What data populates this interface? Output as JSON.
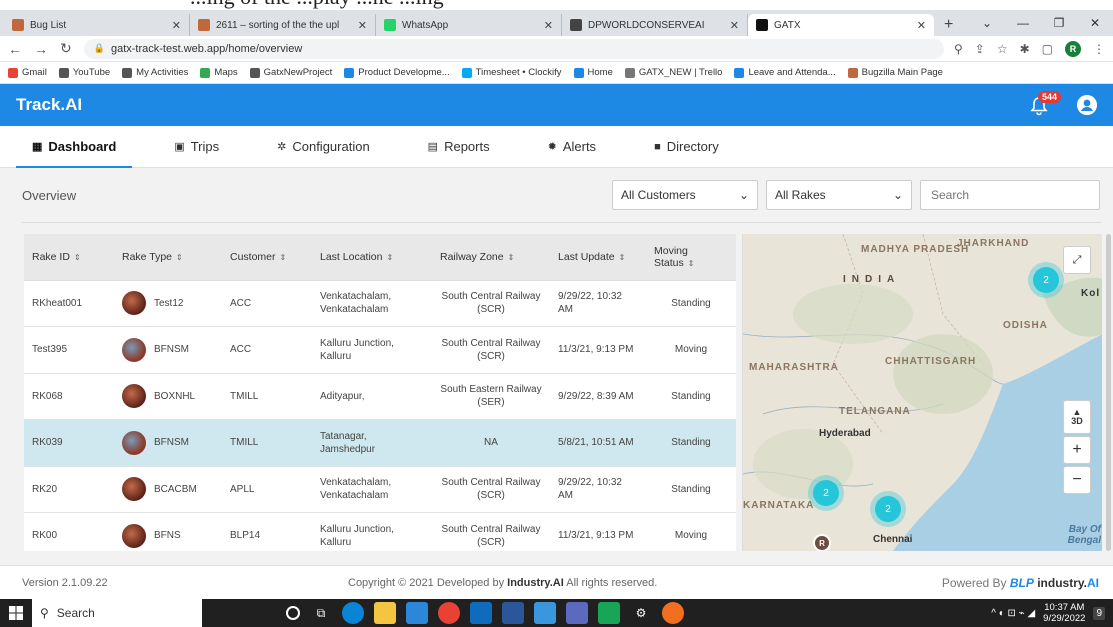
{
  "top_caption": "...ing of the ...play ...ne ...ing",
  "browser": {
    "tabs": [
      {
        "label": "Bug List",
        "color": "#c0673c",
        "active": false
      },
      {
        "label": "2611 – sorting of the the upl",
        "color": "#c0673c",
        "active": false
      },
      {
        "label": "WhatsApp",
        "color": "#25d366",
        "active": false
      },
      {
        "label": "DPWORLDCONSERVEAI",
        "color": "#444444",
        "active": false
      },
      {
        "label": "GATX",
        "color": "#111111",
        "active": true
      }
    ],
    "url": "gatx-track-test.web.app/home/overview",
    "profile_initial": "R",
    "bookmarks": [
      {
        "label": "Gmail",
        "color": "#ea4335"
      },
      {
        "label": "YouTube",
        "color": "#555555"
      },
      {
        "label": "My Activities",
        "color": "#555555"
      },
      {
        "label": "Maps",
        "color": "#34a853"
      },
      {
        "label": "GatxNewProject",
        "color": "#555555"
      },
      {
        "label": "Product Developme...",
        "color": "#1e88e5"
      },
      {
        "label": "Timesheet • Clockify",
        "color": "#03a9f4"
      },
      {
        "label": "Home",
        "color": "#1e88e5"
      },
      {
        "label": "GATX_NEW | Trello",
        "color": "#777777"
      },
      {
        "label": "Leave and Attenda...",
        "color": "#1e88e5"
      },
      {
        "label": "Bugzilla Main Page",
        "color": "#c0673c"
      }
    ]
  },
  "app": {
    "brand": "Track.AI",
    "notification_count": "544",
    "nav": [
      {
        "label": "Dashboard",
        "icon": "dashboard-icon",
        "glyph": "▦",
        "active": true
      },
      {
        "label": "Trips",
        "icon": "trips-icon",
        "glyph": "▣",
        "active": false
      },
      {
        "label": "Configuration",
        "icon": "gear-icon",
        "glyph": "✲",
        "active": false
      },
      {
        "label": "Reports",
        "icon": "report-icon",
        "glyph": "▤",
        "active": false
      },
      {
        "label": "Alerts",
        "icon": "alerts-icon",
        "glyph": "✹",
        "active": false
      },
      {
        "label": "Directory",
        "icon": "folder-icon",
        "glyph": "■",
        "active": false
      }
    ],
    "overview_title": "Overview",
    "customer_select": "All Customers",
    "rake_select": "All Rakes",
    "search_placeholder": "Search"
  },
  "table": {
    "headers": [
      "Rake ID",
      "Rake Type",
      "Customer",
      "Last Location",
      "Railway Zone",
      "Last Update",
      "Moving Status"
    ],
    "rows": [
      {
        "rake_id": "RKheat001",
        "rake_type": "Test12",
        "customer": "ACC",
        "location": "Venkatachalam, Venkatachalam",
        "zone": "South Central Railway (SCR)",
        "update": "9/29/22, 10:32 AM",
        "status": "Standing",
        "highlight": false
      },
      {
        "rake_id": "Test395",
        "rake_type": "BFNSM",
        "customer": "ACC",
        "location": "Kalluru Junction, Kalluru",
        "zone": "South Central Railway (SCR)",
        "update": "11/3/21, 9:13 PM",
        "status": "Moving",
        "highlight": false
      },
      {
        "rake_id": "RK068",
        "rake_type": "BOXNHL",
        "customer": "TMILL",
        "location": "Adityapur,",
        "zone": "South Eastern Railway (SER)",
        "update": "9/29/22, 8:39 AM",
        "status": "Standing",
        "highlight": false
      },
      {
        "rake_id": "RK039",
        "rake_type": "BFNSM",
        "customer": "TMILL",
        "location": "Tatanagar, Jamshedpur",
        "zone": "NA",
        "update": "5/8/21, 10:51 AM",
        "status": "Standing",
        "highlight": true
      },
      {
        "rake_id": "RK20",
        "rake_type": "BCACBM",
        "customer": "APLL",
        "location": "Venkatachalam, Venkatachalam",
        "zone": "South Central Railway (SCR)",
        "update": "9/29/22, 10:32 AM",
        "status": "Standing",
        "highlight": false
      },
      {
        "rake_id": "RK00",
        "rake_type": "BFNS",
        "customer": "BLP14",
        "location": "Kalluru Junction, Kalluru",
        "zone": "South Central Railway (SCR)",
        "update": "11/3/21, 9:13 PM",
        "status": "Moving",
        "highlight": false
      }
    ]
  },
  "map": {
    "labels": [
      "MADHYA PRADESH",
      "JHARKHAND",
      "INDIA",
      "Kol",
      "ODISHA",
      "MAHARASHTRA",
      "CHHATTISGARH",
      "TELANGANA",
      "Hyderabad",
      "KARNATAKA",
      "Chennai",
      "Bay Of Bengal"
    ],
    "clusters": [
      "2",
      "2",
      "2"
    ],
    "marker": "R",
    "btn_3d": "3D",
    "zoom_in": "+",
    "zoom_out": "−"
  },
  "footer": {
    "version": "Version 2.1.09.22",
    "copyright_prefix": "Copyright © 2021 Developed by ",
    "copyright_brand": "Industry.AI",
    "copyright_suffix": " All rights reserved.",
    "powered": "Powered By",
    "blp": "BLP",
    "industry": "industry.",
    "ai": "AI"
  },
  "taskbar": {
    "search": "Search",
    "time": "10:37 AM",
    "date": "9/29/2022",
    "notif": "9"
  }
}
